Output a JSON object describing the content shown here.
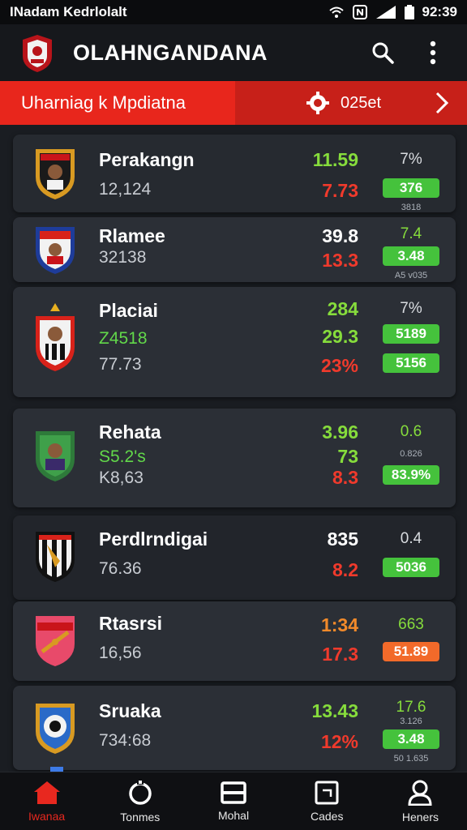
{
  "status_bar": {
    "left_text": "INadam Kedrlolalt",
    "time": "92:39"
  },
  "app": {
    "title": "OLAHNGANDANA"
  },
  "banner": {
    "left_text": "Uharniag k Mpdiatna",
    "right_text": "025et"
  },
  "colors": {
    "accent_red": "#e8281f",
    "positive_green": "#45c23c",
    "orange": "#f26a2a",
    "card_bg": "#2b2f36"
  },
  "rows": [
    {
      "name": "Perakangn",
      "sub1": "12,124",
      "val1": "11.59",
      "val2": "7.73",
      "pct": "7%",
      "pill": "376",
      "tiny": "3818"
    },
    {
      "name": "Rlamee",
      "sub1": "32138",
      "val1": "39.8",
      "val2": "13.3",
      "pct": "7.4",
      "pill": "3.48",
      "tiny": "A5 v035"
    },
    {
      "name": "Placiai",
      "sub1": "Z4518",
      "sub2": "77.73",
      "val1": "284",
      "val2": "29.3",
      "val3": "23%",
      "pct": "7%",
      "pill1": "5189",
      "pill2": "5156"
    },
    {
      "name": "Rehata",
      "sub1": "S5.2's",
      "sub2": "K8,63",
      "val1": "3.96",
      "val2": "73",
      "val3": "8.3",
      "pct": "0.6",
      "tiny": "0.826",
      "pill": "83.9%"
    },
    {
      "name": "Perdlrndigai",
      "sub1": "76.36",
      "val1": "835",
      "val2": "8.2",
      "pct": "0.4",
      "pill": "5036"
    },
    {
      "name": "Rtasrsi",
      "sub1": "16,56",
      "val1": "1:34",
      "val2": "17.3",
      "pct": "663",
      "pill": "51.89"
    },
    {
      "name": "Sruaka",
      "sub1": "734:68",
      "val1": "13.43",
      "val2": "12%",
      "pct": "17.6",
      "tiny1": "3.126",
      "pill": "3.48",
      "tiny2": "50 1.635"
    }
  ],
  "nav": [
    {
      "label": "Iwanaa",
      "icon": "home-icon"
    },
    {
      "label": "Tonmes",
      "icon": "refresh-icon"
    },
    {
      "label": "Mohal",
      "icon": "menu-icon"
    },
    {
      "label": "Cades",
      "icon": "card-icon"
    },
    {
      "label": "Heners",
      "icon": "user-icon"
    }
  ]
}
